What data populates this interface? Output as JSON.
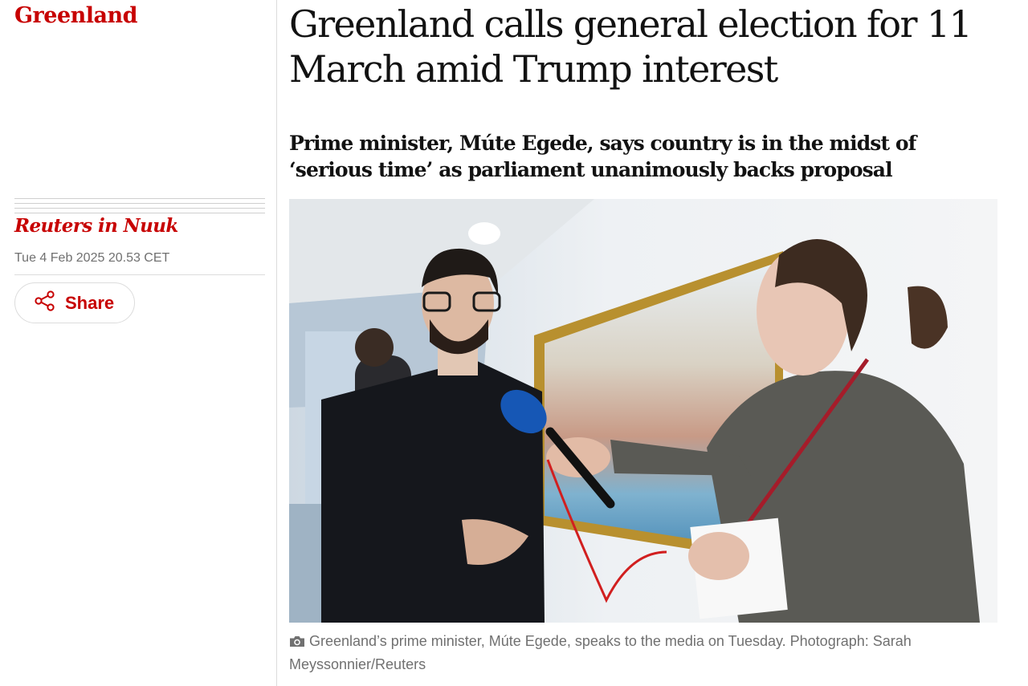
{
  "section": {
    "label": "Greenland"
  },
  "meta": {
    "byline": "Reuters in Nuuk",
    "date": "Tue 4 Feb 2025 20.53 CET",
    "share_label": "Share"
  },
  "article": {
    "headline": "Greenland calls general election for 11 March amid Trump interest",
    "standfirst": "Prime minister, Múte Egede, says country is in the midst of ‘serious time’ as parliament unanimously backs proposal"
  },
  "photo": {
    "caption": "Greenland’s prime minister, Múte Egede, speaks to the media on Tuesday. Photograph: Sarah Meyssonnier/Reuters",
    "icon": "camera-icon"
  },
  "colors": {
    "accent": "#c70000",
    "text": "#121212",
    "muted": "#707070",
    "divider": "#dcdcdc"
  }
}
